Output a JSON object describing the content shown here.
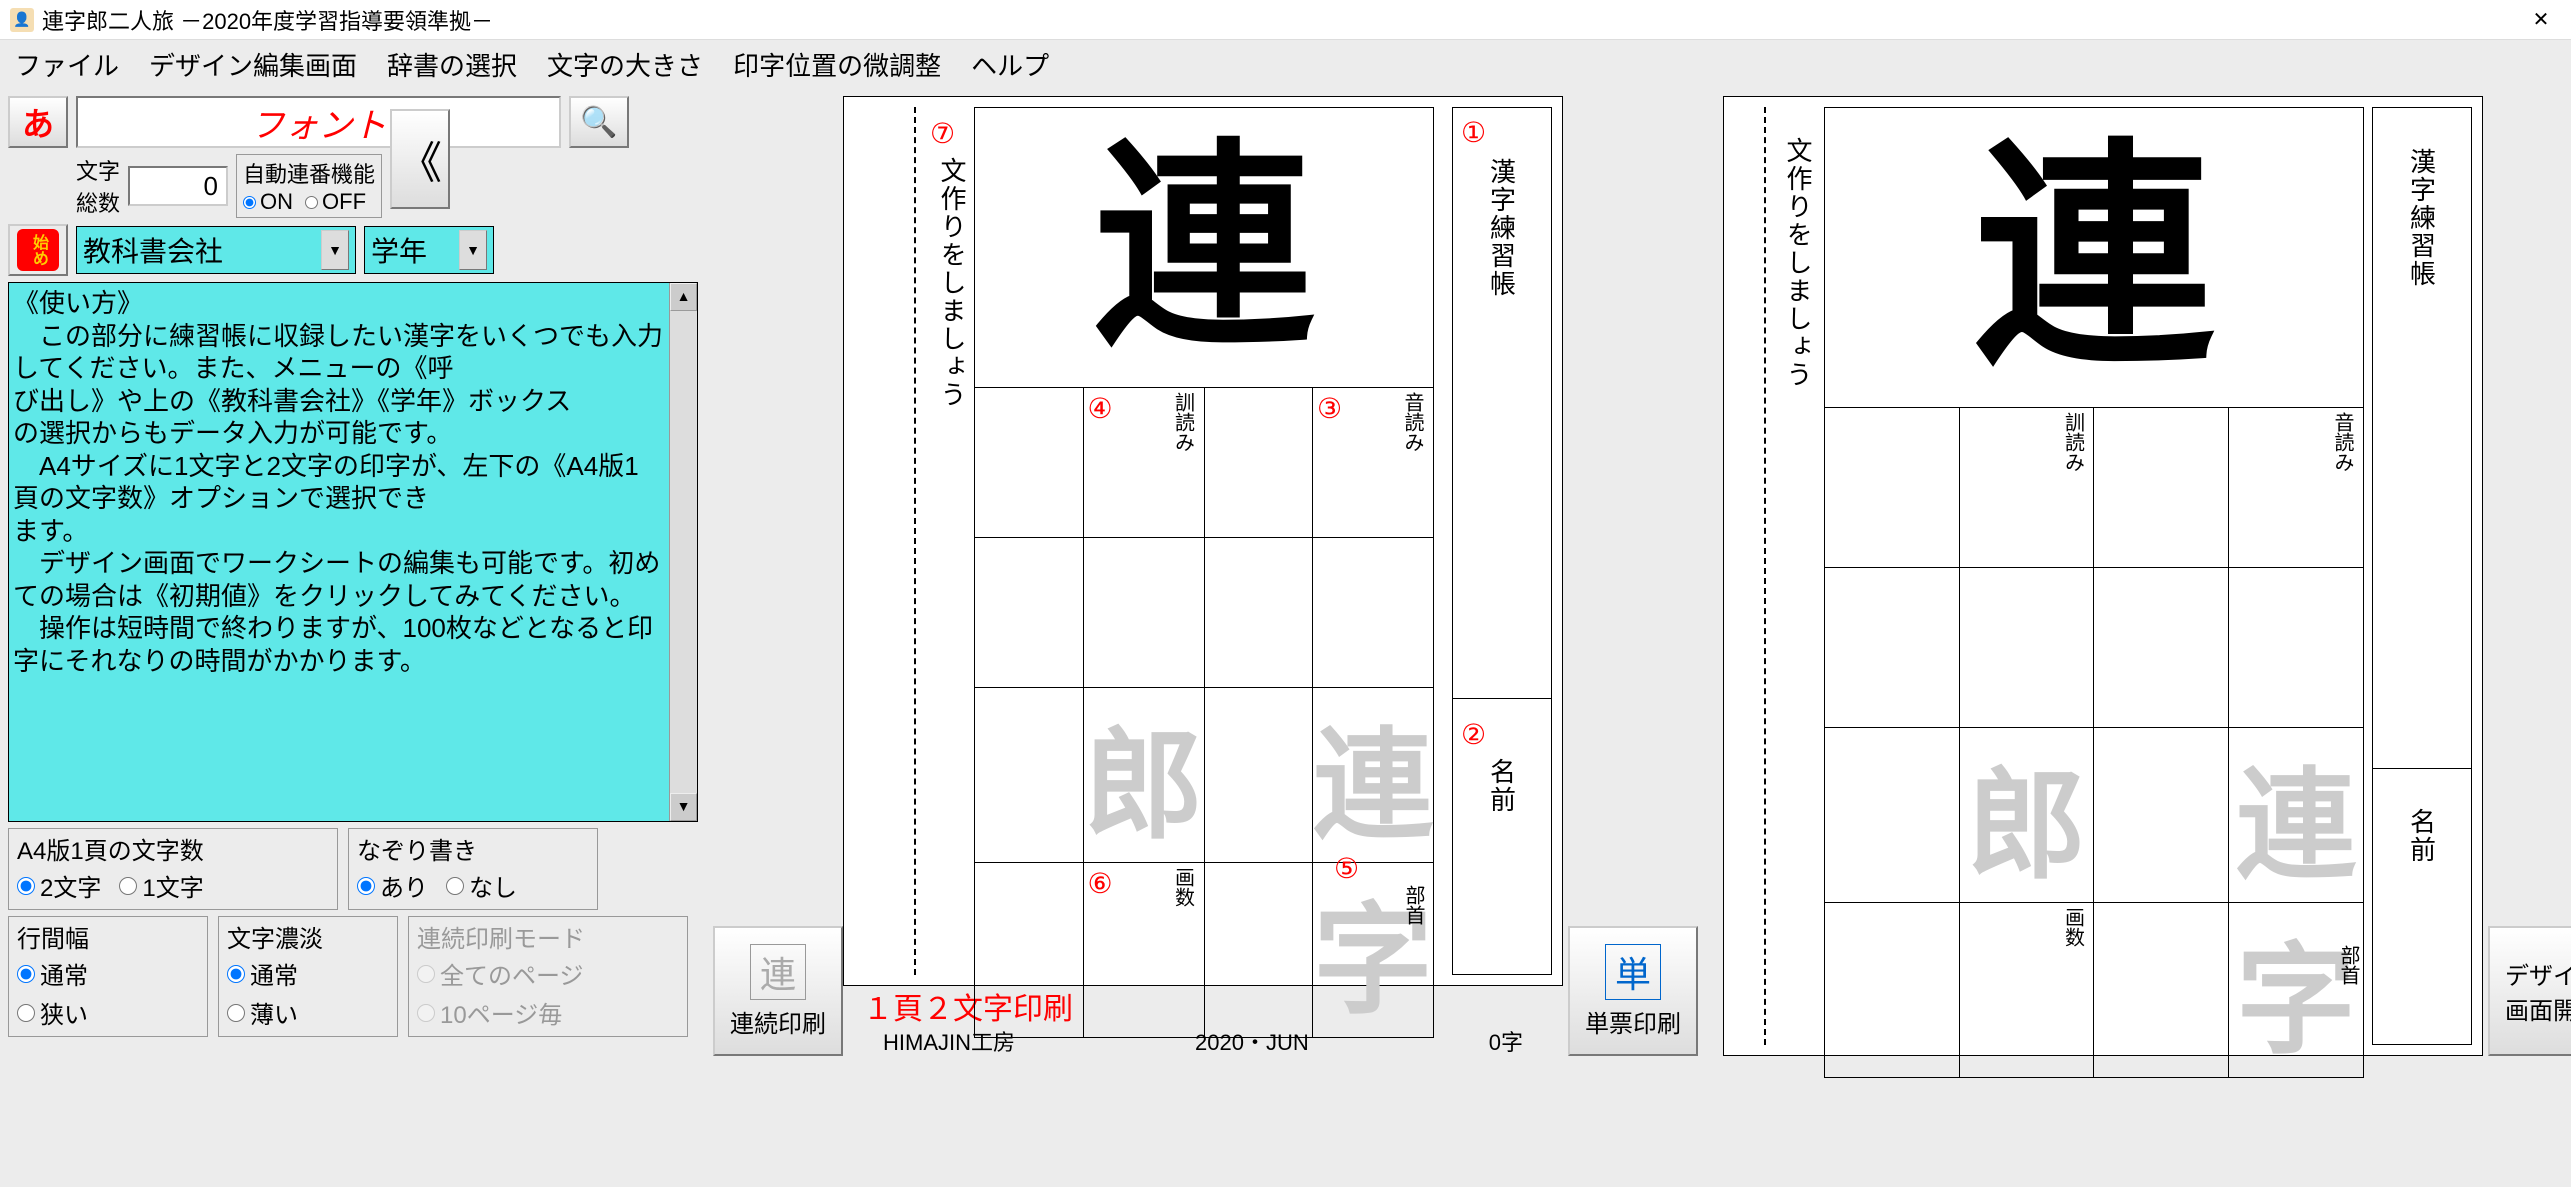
{
  "title": "連字郎二人旅 －2020年度学習指導要領準拠－",
  "menu": [
    "ファイル",
    "デザイン編集画面",
    "辞書の選択",
    "文字の大きさ",
    "印字位置の微調整",
    "ヘルプ"
  ],
  "side": {
    "a_btn": "あ",
    "font_label": "フォント",
    "char_total_label": "文字\n総数",
    "char_total_value": "0",
    "seq_title": "自動連番機能",
    "seq_on": "ON",
    "seq_off": "OFF",
    "start_btn": "始め",
    "combo1": "教科書会社",
    "combo2": "学年",
    "help_text": "《使い方》\n　この部分に練習帳に収録したい漢字をいくつでも入力してください。また、メニューの《呼\nび出し》や上の《教科書会社》《学年》ボックス\nの選択からもデータ入力が可能です。\n　A4サイズに1文字と2文字の印字が、左下の《A4版1頁の文字数》オプションで選択でき\nます。\n　デザイン画面でワークシートの編集も可能です。初めての場合は《初期値》をクリックしてみてください。\n　操作は短時間で終わりますが、100枚などとなると印字にそれなりの時間がかかります。",
    "a4_title": "A4版1頁の文字数",
    "a4_opt1": "2文字",
    "a4_opt2": "1文字",
    "trace_title": "なぞり書き",
    "trace_opt1": "あり",
    "trace_opt2": "なし",
    "linew_title": "行間幅",
    "linew_opt1": "通常",
    "linew_opt2": "狭い",
    "shade_title": "文字濃淡",
    "shade_opt1": "通常",
    "shade_opt2": "薄い",
    "contprint_title": "連続印刷モード",
    "contprint_opt1": "全てのページ",
    "contprint_opt2": "10ページ毎",
    "cont_print_btn": "連続印刷"
  },
  "sheet": {
    "big_kanji": "連",
    "title_v": "漢字練習帳",
    "name_v": "名前",
    "sentence_v": "文作りをしましょう",
    "onyomi": "音読み",
    "kunyomi": "訓読み",
    "kakusu": "画数",
    "bushu": "部首",
    "gray1": "連",
    "gray2": "字",
    "gray3": "郎",
    "c1": "①",
    "c2": "②",
    "c3": "③",
    "c4": "④",
    "c5": "⑤",
    "c6": "⑥",
    "c7": "⑦"
  },
  "foot": {
    "red": "１頁２文字印刷",
    "maker": "HIMAJIN工房",
    "date": "2020・JUN",
    "count": "0字"
  },
  "btns": {
    "single_print": "単票印刷",
    "design_open": "デザイン\n画面開く"
  }
}
